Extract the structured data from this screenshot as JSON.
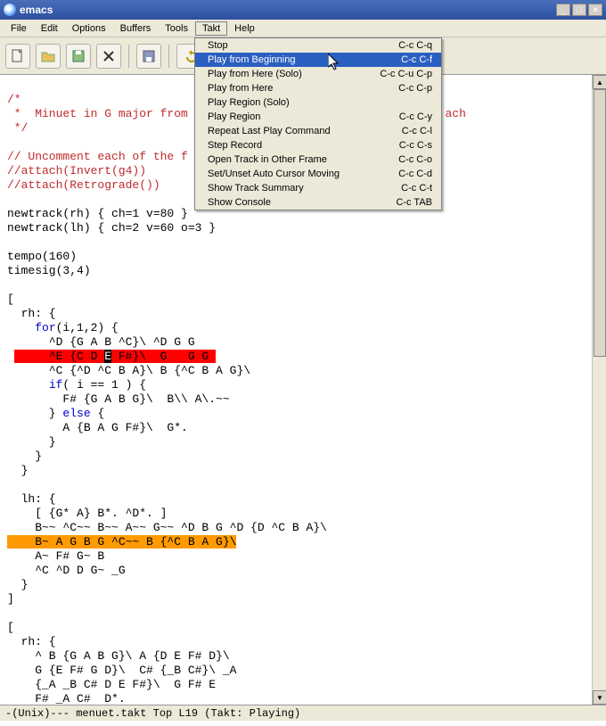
{
  "window": {
    "title": "emacs"
  },
  "menubar": [
    "File",
    "Edit",
    "Options",
    "Buffers",
    "Tools",
    "Takt",
    "Help"
  ],
  "open_menu_index": 5,
  "dropdown": [
    {
      "label": "Stop",
      "shortcut": "C-c C-q",
      "sel": false
    },
    {
      "label": "Play from Beginning",
      "shortcut": "C-c C-f",
      "sel": true
    },
    {
      "label": "Play from Here (Solo)",
      "shortcut": "C-c C-u C-p",
      "sel": false
    },
    {
      "label": "Play from Here",
      "shortcut": "C-c C-p",
      "sel": false
    },
    {
      "label": "Play Region (Solo)",
      "shortcut": "",
      "sel": false
    },
    {
      "label": "Play Region",
      "shortcut": "C-c C-y",
      "sel": false
    },
    {
      "label": "Repeat Last Play Command",
      "shortcut": "C-c C-l",
      "sel": false
    },
    {
      "label": "Step Record",
      "shortcut": "C-c C-s",
      "sel": false
    },
    {
      "label": "Open Track in Other Frame",
      "shortcut": "C-c C-o",
      "sel": false
    },
    {
      "label": "Set/Unset Auto Cursor Moving",
      "shortcut": "C-c C-d",
      "sel": false
    },
    {
      "label": "Show Track Summary",
      "shortcut": "C-c C-t",
      "sel": false
    },
    {
      "label": "Show Console",
      "shortcut": "C-c TAB",
      "sel": false
    }
  ],
  "code": {
    "c1": "/*",
    "c2": " *  Minuet in G major from                                     ach",
    "c3": " */",
    "c4": "// Uncomment each of the f",
    "c5": "//attach(Invert(g4))",
    "c6": "//attach(Retrograde())",
    "l1": "newtrack(rh) { ch=1 v=80 }",
    "l2": "newtrack(lh) { ch=2 v=60 o=3 }",
    "l3": "tempo(160)",
    "l4": "timesig(3,4)",
    "l5": "[",
    "l6": "  rh: {",
    "for": "for",
    "l7b": "(i,1,2) {",
    "l8": "      ^D {G A B ^C}\\ ^D G G",
    "hl1a": "     ^E {C D ",
    "hl1caret": "E",
    "hl1b": " F#}\\  G   G G ",
    "l10": "      ^C {^D ^C B A}\\ B {^C B A G}\\",
    "if": "if",
    "l11b": "( i == 1 ) {",
    "l12": "        F# {G A B G}\\  B\\\\ A\\.~~",
    "else": "else",
    "l13a": "      } ",
    "l13c": " {",
    "l14": "        A {B A G F#}\\  G*.",
    "l15": "      }",
    "l16": "    }",
    "l17": "  }",
    "l18": "  lh: {",
    "l19": "    [ {G* A} B*. ^D*. ]",
    "l20": "    B~~ ^C~~ B~~ A~~ G~~ ^D B G ^D {D ^C B A}\\",
    "hl2": "    B~ A G B G ^C~~ B {^C B A G}\\",
    "l22": "    A~ F# G~ B",
    "l23": "    ^C ^D D G~ _G",
    "l24": "  }",
    "l25": "]",
    "l26": "[",
    "l27": "  rh: {",
    "l28": "    ^ B {G A B G}\\ A {D E F# D}\\",
    "l29": "    G {E F# G D}\\  C# {_B C#}\\ _A",
    "l30": "    {_A _B C# D E F#}\\  G F# E",
    "l31": "    F# _A C#  D*."
  },
  "modeline": "-(Unix)---  menuet.takt    Top L19    (Takt: Playing)"
}
